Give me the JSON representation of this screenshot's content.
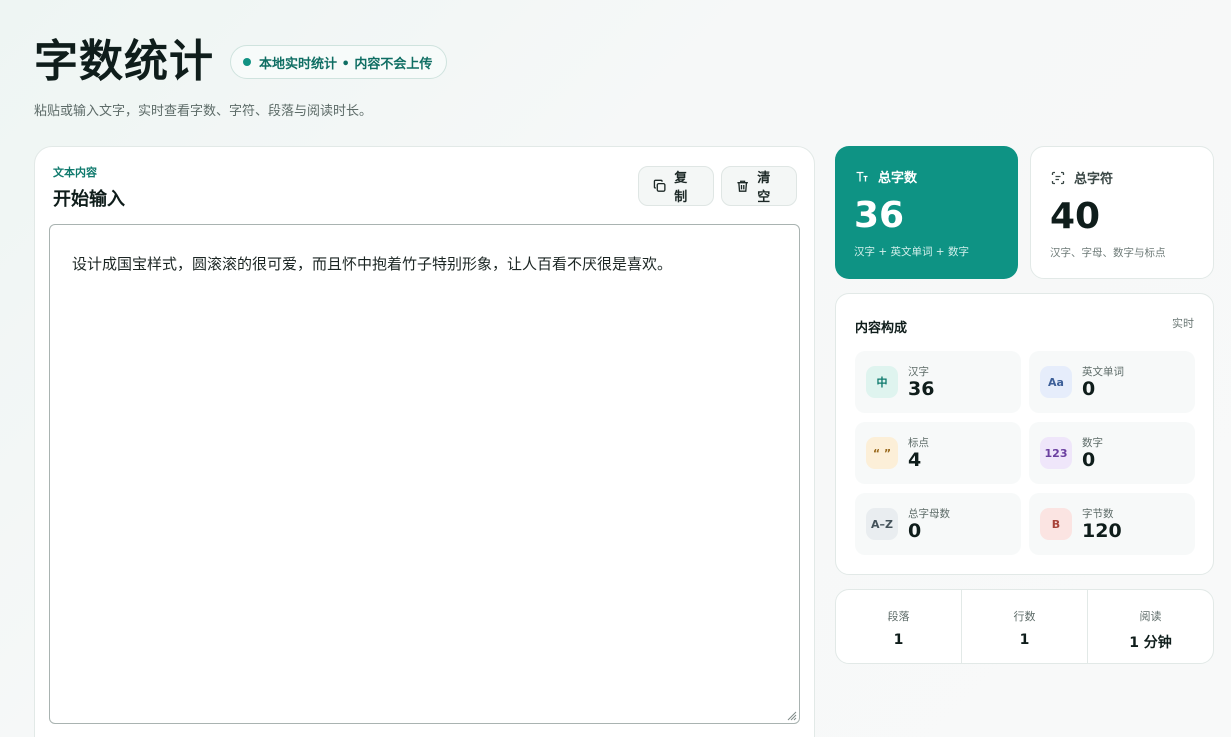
{
  "header": {
    "title": "字数统计",
    "badge": "本地实时统计 • 内容不会上传",
    "subtitle": "粘贴或输入文字，实时查看字数、字符、段落与阅读时长。"
  },
  "editor": {
    "kicker": "文本内容",
    "title": "开始输入",
    "copy_label": "复制",
    "clear_label": "清空",
    "text": "设计成国宝样式，圆滚滚的很可爱，而且怀中抱着竹子特别形象，让人百看不厌很是喜欢。"
  },
  "stats": {
    "total_words": {
      "label": "总字数",
      "value": "36",
      "desc": "汉字 + 英文单词 + 数字",
      "icon": "text-size-icon"
    },
    "total_chars": {
      "label": "总字符",
      "value": "40",
      "desc": "汉字、字母、数字与标点",
      "icon": "scan-text-icon"
    }
  },
  "composition": {
    "title": "内容构成",
    "live": "实时",
    "items": [
      {
        "icon_text": "中",
        "label": "汉字",
        "value": "36",
        "bg": "#dff4ef",
        "fg": "#0e7a6d"
      },
      {
        "icon_text": "Aa",
        "label": "英文单词",
        "value": "0",
        "bg": "#e6edfb",
        "fg": "#3d5f98"
      },
      {
        "icon_text": "“ ”",
        "label": "标点",
        "value": "4",
        "bg": "#fcefd8",
        "fg": "#9a6a1e"
      },
      {
        "icon_text": "123",
        "label": "数字",
        "value": "0",
        "bg": "#efe6fa",
        "fg": "#6b3fa0"
      },
      {
        "icon_text": "A–Z",
        "label": "总字母数",
        "value": "0",
        "bg": "#e9edf0",
        "fg": "#44525a"
      },
      {
        "icon_text": "B",
        "label": "字节数",
        "value": "120",
        "bg": "#fbe4e2",
        "fg": "#a8433a"
      }
    ]
  },
  "summary": [
    {
      "label": "段落",
      "value": "1"
    },
    {
      "label": "行数",
      "value": "1"
    },
    {
      "label": "阅读",
      "value": "1 分钟"
    }
  ],
  "colors": {
    "accent": "#0e9384"
  }
}
